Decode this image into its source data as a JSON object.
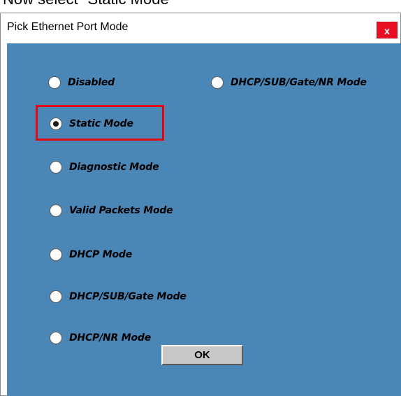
{
  "caption": "Now select \"Static Mode\"",
  "dialog": {
    "title": "Pick Ethernet Port Mode",
    "close_label": "x",
    "ok_label": "OK"
  },
  "options": [
    {
      "label": "Disabled",
      "selected": false
    },
    {
      "label": "DHCP/SUB/Gate/NR Mode",
      "selected": false
    },
    {
      "label": "Static Mode",
      "selected": true
    },
    {
      "label": "Diagnostic Mode",
      "selected": false
    },
    {
      "label": "Valid Packets Mode",
      "selected": false
    },
    {
      "label": "DHCP Mode",
      "selected": false
    },
    {
      "label": "DHCP/SUB/Gate Mode",
      "selected": false
    },
    {
      "label": "DHCP/NR Mode",
      "selected": false
    }
  ],
  "colors": {
    "client_background": "#4a86b6",
    "highlight": "#e30613",
    "close_button": "#e81123",
    "ok_button": "#c8c8c8"
  }
}
